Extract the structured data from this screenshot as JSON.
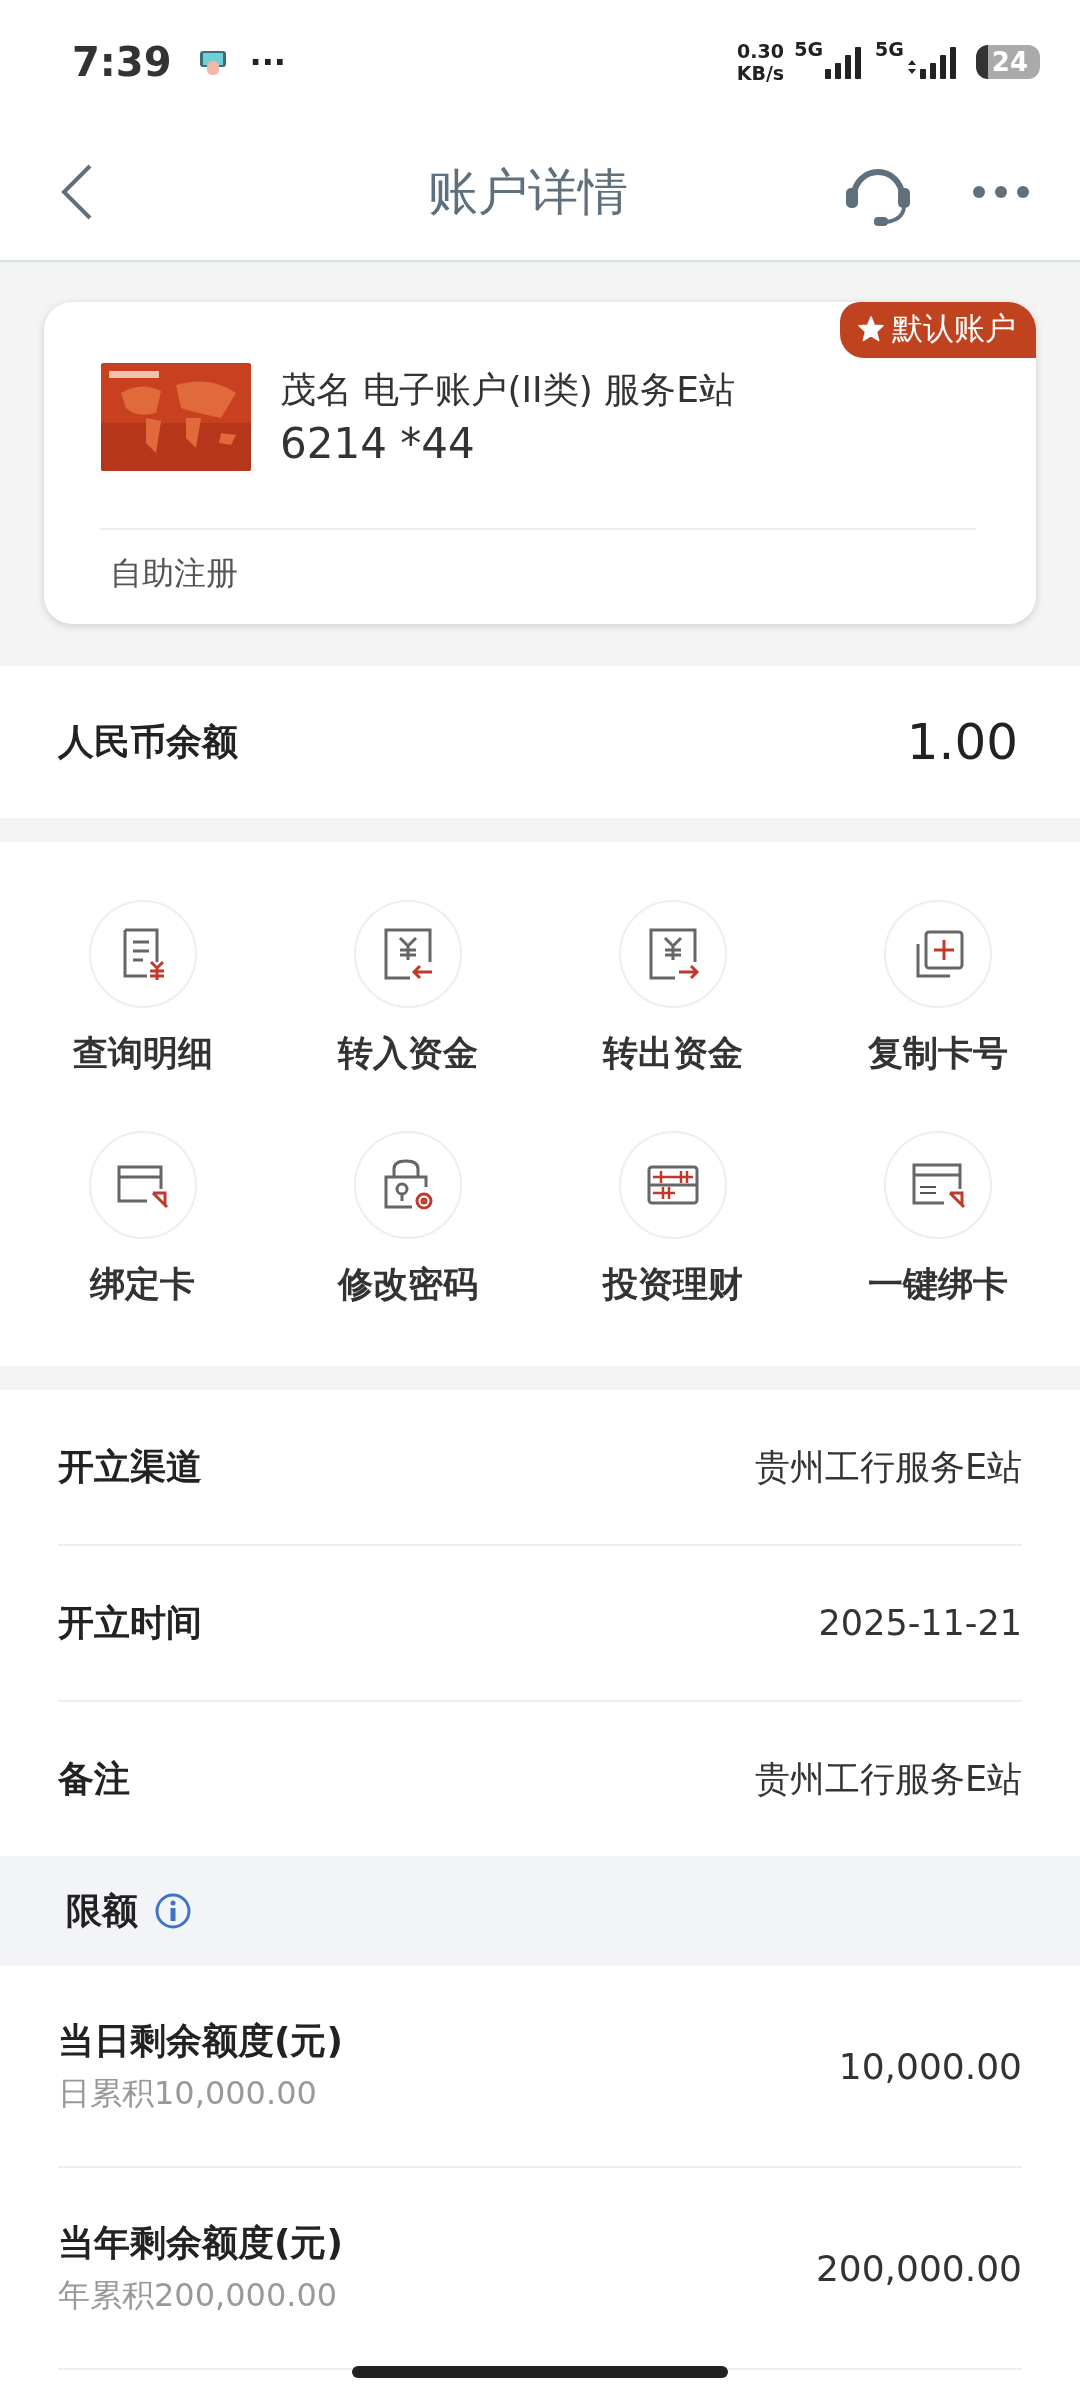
{
  "status_bar": {
    "time": "7:39",
    "more": "···",
    "speed_value": "0.30",
    "speed_unit": "KB/s",
    "sim1": "5G",
    "sim2": "5G",
    "battery": "24"
  },
  "nav": {
    "title": "账户详情"
  },
  "account_card": {
    "badge": "默认账户",
    "name": "茂名 电子账户(II类) 服务E站",
    "number": "6214 *44",
    "footer": "自助注册"
  },
  "balance": {
    "label": "人民币余额",
    "value": "1.00"
  },
  "actions": [
    {
      "label": "查询明细",
      "kind": "detail"
    },
    {
      "label": "转入资金",
      "kind": "transfer_in"
    },
    {
      "label": "转出资金",
      "kind": "transfer_out"
    },
    {
      "label": "复制卡号",
      "kind": "copy"
    },
    {
      "label": "绑定卡",
      "kind": "bind"
    },
    {
      "label": "修改密码",
      "kind": "password"
    },
    {
      "label": "投资理财",
      "kind": "invest"
    },
    {
      "label": "一键绑卡",
      "kind": "pay"
    }
  ],
  "info_rows": [
    {
      "label": "开立渠道",
      "value": "贵州工行服务E站"
    },
    {
      "label": "开立时间",
      "value": "2025-11-21"
    },
    {
      "label": "备注",
      "value": "贵州工行服务E站"
    }
  ],
  "limits": {
    "title": "限额",
    "rows": [
      {
        "label": "当日剩余额度(元)",
        "sub": "日累积10,000.00",
        "value": "10,000.00"
      },
      {
        "label": "当年剩余额度(元)",
        "sub": "年累积200,000.00",
        "value": "200,000.00"
      }
    ]
  }
}
